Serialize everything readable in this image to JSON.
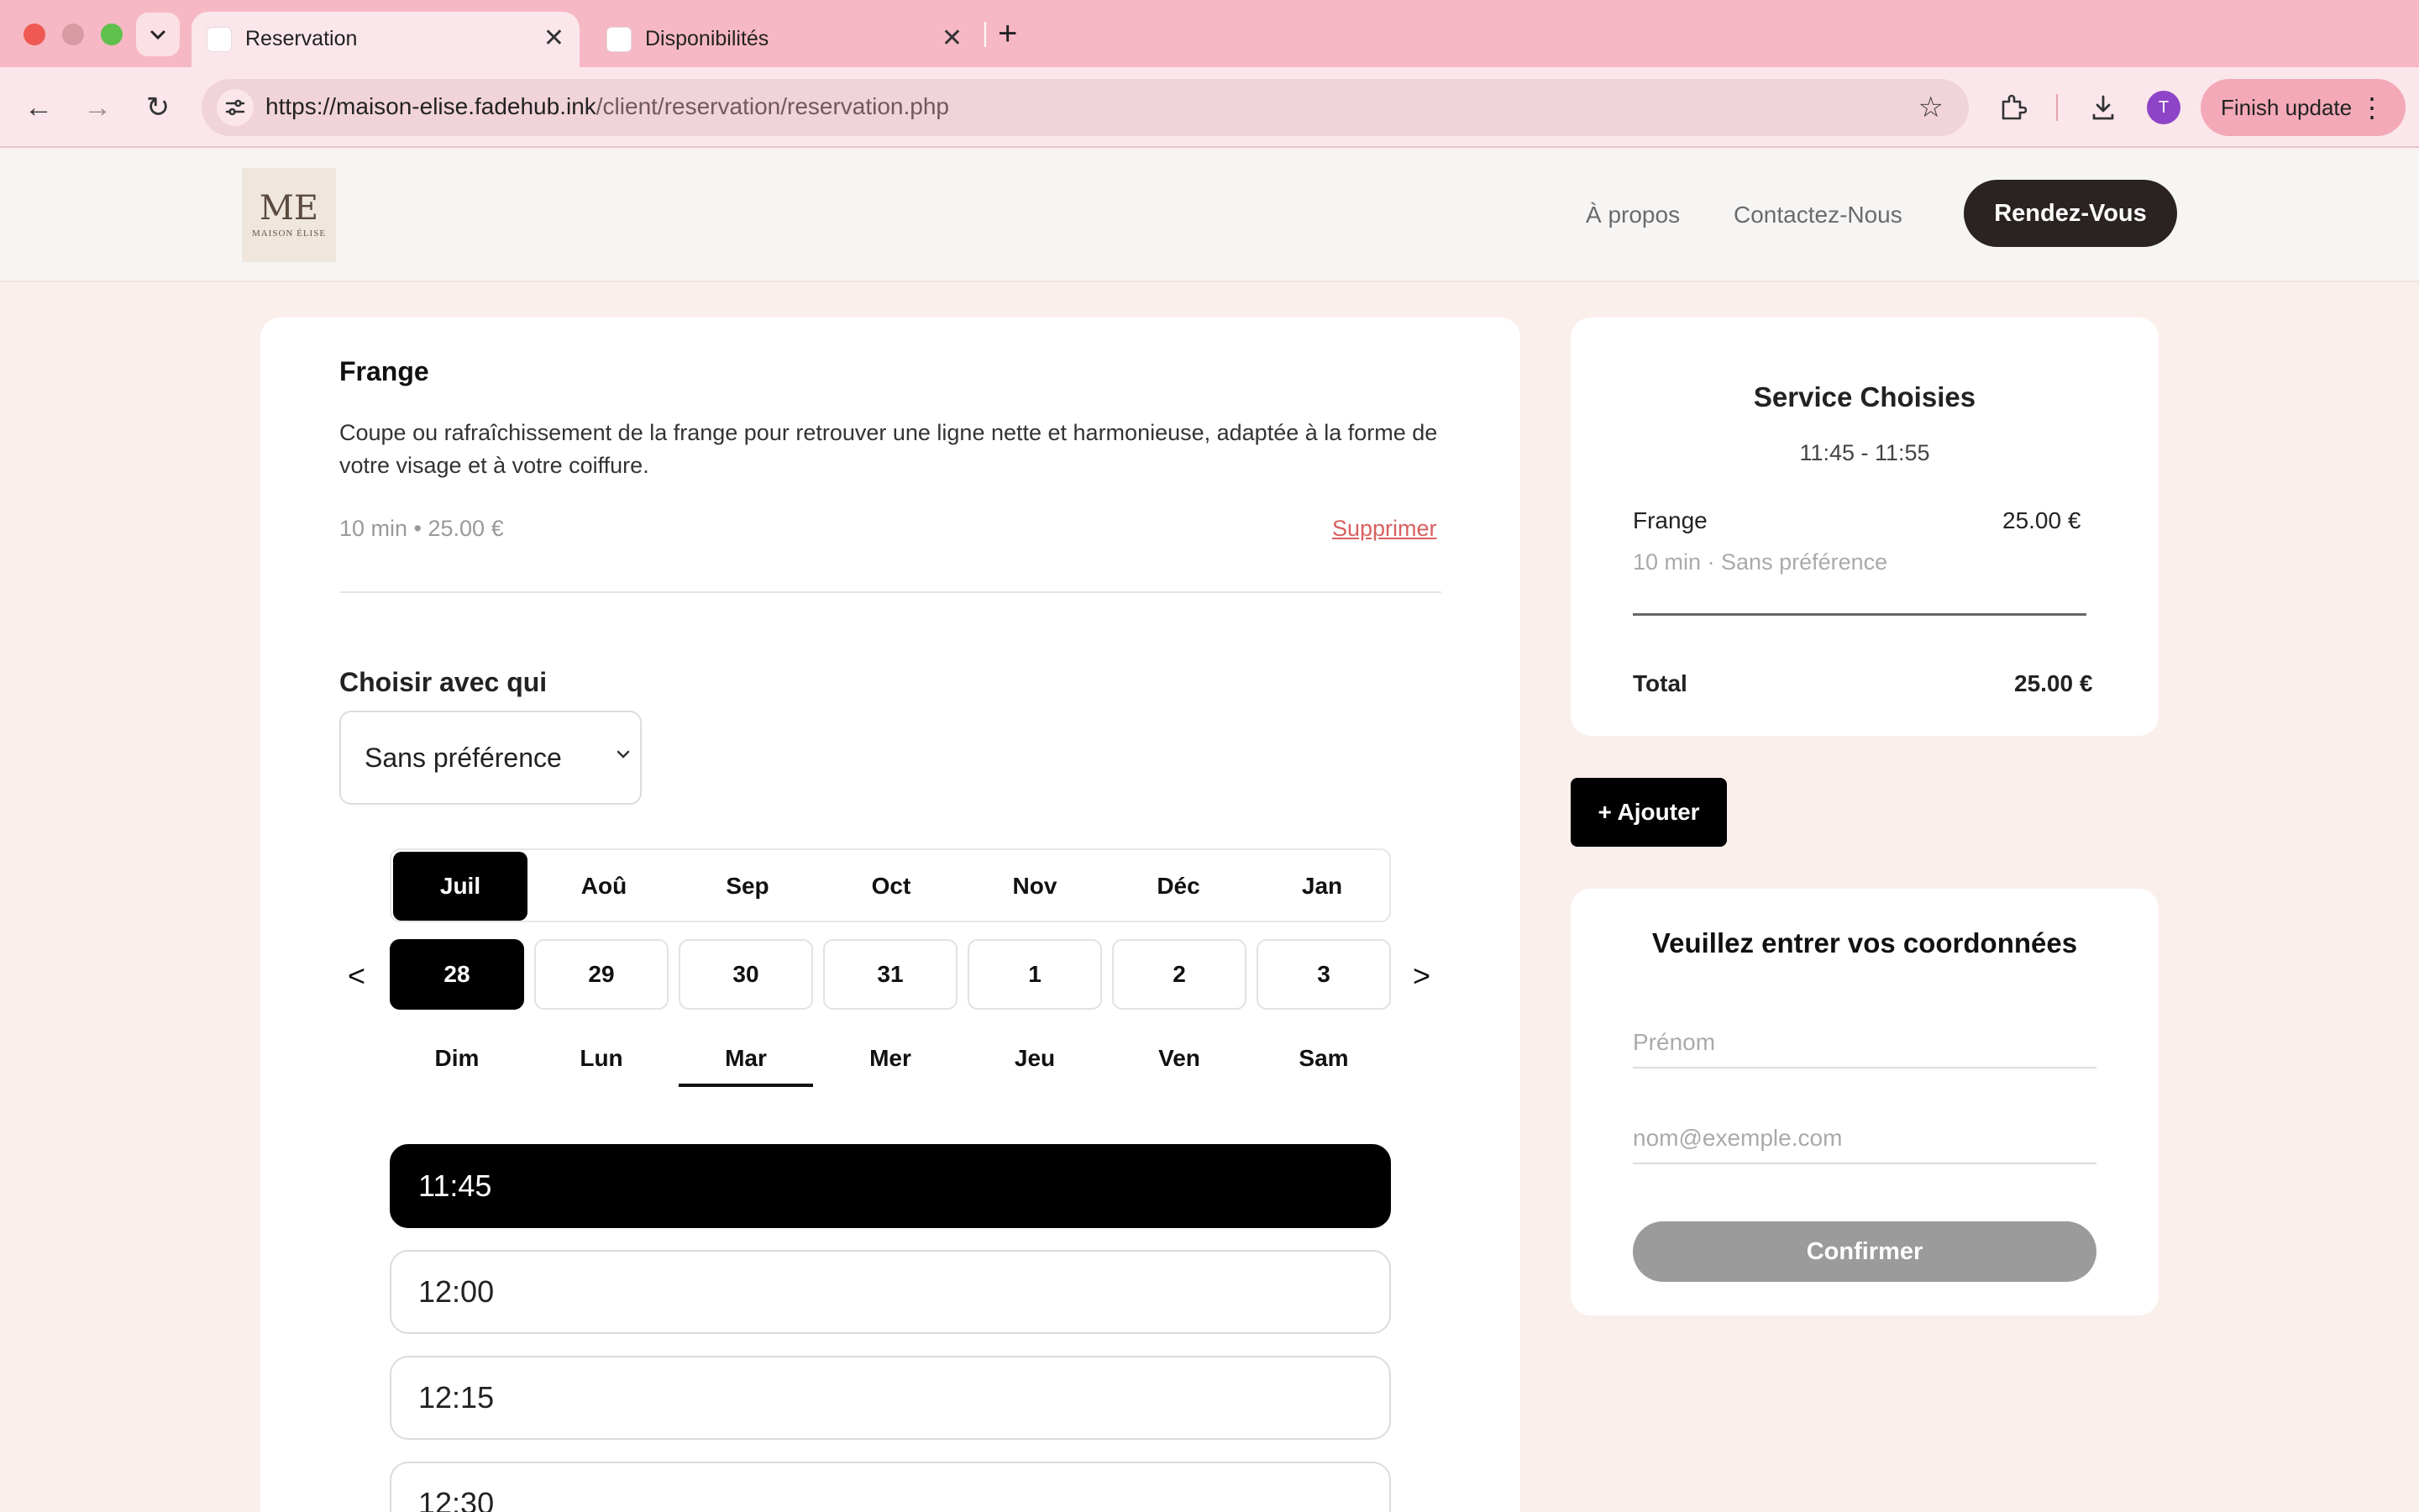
{
  "browser": {
    "tabs": [
      {
        "title": "Reservation",
        "active": true
      },
      {
        "title": "Disponibilités",
        "active": false
      }
    ],
    "url_host": "https://maison-elise.fadehub.ink",
    "url_path": "/client/reservation/reservation.php",
    "avatar_letter": "T",
    "update_label": "Finish update"
  },
  "site": {
    "logo_monogram": "ME",
    "logo_name": "MAISON ÉLISE",
    "nav": [
      "À propos",
      "Contactez-Nous"
    ],
    "cta": "Rendez-Vous"
  },
  "service": {
    "name": "Frange",
    "description": "Coupe ou rafraîchissement de la frange pour retrouver une ligne nette et harmonieuse, adaptée à la forme de votre visage et à votre coiffure.",
    "meta": "10 min • 25.00 €",
    "delete_label": "Supprimer"
  },
  "staff": {
    "label": "Choisir avec qui",
    "selected": "Sans préférence"
  },
  "calendar": {
    "months": [
      "Juil",
      "Aoû",
      "Sep",
      "Oct",
      "Nov",
      "Déc",
      "Jan"
    ],
    "selected_month": "Juil",
    "prev": "<",
    "next": ">",
    "days": [
      "28",
      "29",
      "30",
      "31",
      "1",
      "2",
      "3"
    ],
    "selected_day": "28",
    "weekdays": [
      "Dim",
      "Lun",
      "Mar",
      "Mer",
      "Jeu",
      "Ven",
      "Sam"
    ],
    "highlighted_weekday": "Mar"
  },
  "slots": [
    "11:45",
    "12:00",
    "12:15",
    "12:30"
  ],
  "selected_slot": "11:45",
  "summary": {
    "title": "Service Choisies",
    "time": "11:45 - 11:55",
    "item_name": "Frange",
    "item_price": "25.00 €",
    "item_sub": "10 min · Sans préférence",
    "total_label": "Total",
    "total_value": "25.00 €"
  },
  "add_label": "+ Ajouter",
  "form": {
    "title": "Veuillez entrer vos coordonnées",
    "first_name_placeholder": "Prénom",
    "email_placeholder": "nom@exemple.com",
    "confirm_label": "Confirmer"
  },
  "colors": {
    "chrome_pink": "#f6b8c4",
    "page_bg": "#fbefec",
    "accent_dark": "#2a2322",
    "danger": "#d86060",
    "selected": "#000000",
    "avatar": "#8e44c6"
  }
}
